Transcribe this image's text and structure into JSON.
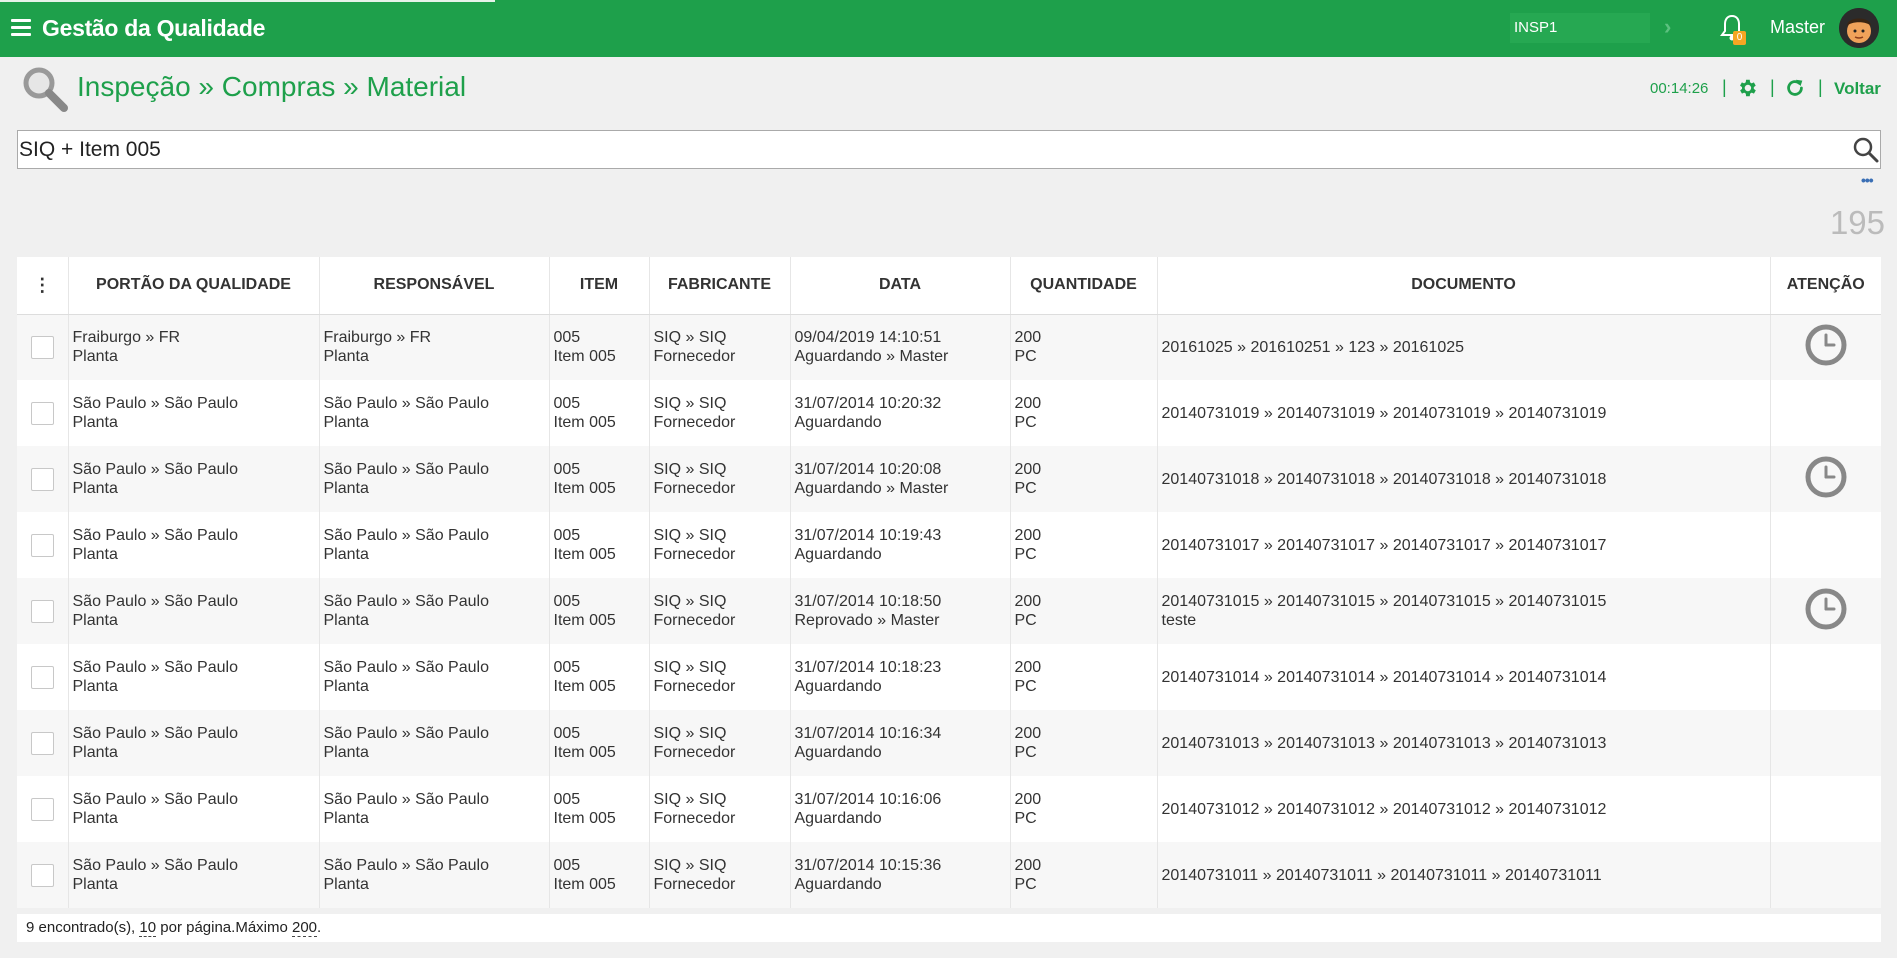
{
  "app": {
    "title": "Gestão da Qualidade"
  },
  "topbar": {
    "inspector": "INSP1",
    "notifications": "0",
    "user": "Master"
  },
  "header": {
    "breadcrumb": "Inspeção » Compras » Material",
    "timer": "00:14:26",
    "back": "Voltar"
  },
  "search": {
    "value": "SIQ + Item 005",
    "count": "195"
  },
  "table": {
    "columns": [
      "PORTÃO DA QUALIDADE",
      "RESPONSÁVEL",
      "ITEM",
      "FABRICANTE",
      "DATA",
      "QUANTIDADE",
      "DOCUMENTO",
      "ATENÇÃO"
    ],
    "rows": [
      {
        "portao1": "Fraiburgo » FR",
        "portao2": "Planta",
        "resp1": "Fraiburgo » FR",
        "resp2": "Planta",
        "item1": "005",
        "item2": "Item 005",
        "fab1": "SIQ » SIQ",
        "fab2": "Fornecedor",
        "data1": "09/04/2019 14:10:51",
        "data2": "Aguardando » Master",
        "qtd1": "200",
        "qtd2": "PC",
        "doc1": "20161025 » 201610251 » 123 » 20161025",
        "doc2": "",
        "atencao": true
      },
      {
        "portao1": "São Paulo » São Paulo",
        "portao2": "Planta",
        "resp1": "São Paulo » São Paulo",
        "resp2": "Planta",
        "item1": "005",
        "item2": "Item 005",
        "fab1": "SIQ » SIQ",
        "fab2": "Fornecedor",
        "data1": "31/07/2014 10:20:32",
        "data2": "Aguardando",
        "qtd1": "200",
        "qtd2": "PC",
        "doc1": "20140731019 » 20140731019 » 20140731019 » 20140731019",
        "doc2": "",
        "atencao": false
      },
      {
        "portao1": "São Paulo » São Paulo",
        "portao2": "Planta",
        "resp1": "São Paulo » São Paulo",
        "resp2": "Planta",
        "item1": "005",
        "item2": "Item 005",
        "fab1": "SIQ » SIQ",
        "fab2": "Fornecedor",
        "data1": "31/07/2014 10:20:08",
        "data2": "Aguardando » Master",
        "qtd1": "200",
        "qtd2": "PC",
        "doc1": "20140731018 » 20140731018 » 20140731018 » 20140731018",
        "doc2": "",
        "atencao": true
      },
      {
        "portao1": "São Paulo » São Paulo",
        "portao2": "Planta",
        "resp1": "São Paulo » São Paulo",
        "resp2": "Planta",
        "item1": "005",
        "item2": "Item 005",
        "fab1": "SIQ » SIQ",
        "fab2": "Fornecedor",
        "data1": "31/07/2014 10:19:43",
        "data2": "Aguardando",
        "qtd1": "200",
        "qtd2": "PC",
        "doc1": "20140731017 » 20140731017 » 20140731017 » 20140731017",
        "doc2": "",
        "atencao": false
      },
      {
        "portao1": "São Paulo » São Paulo",
        "portao2": "Planta",
        "resp1": "São Paulo » São Paulo",
        "resp2": "Planta",
        "item1": "005",
        "item2": "Item 005",
        "fab1": "SIQ » SIQ",
        "fab2": "Fornecedor",
        "data1": "31/07/2014 10:18:50",
        "data2": "Reprovado » Master",
        "qtd1": "200",
        "qtd2": "PC",
        "doc1": "20140731015 » 20140731015 » 20140731015 » 20140731015",
        "doc2": "teste",
        "atencao": true
      },
      {
        "portao1": "São Paulo » São Paulo",
        "portao2": "Planta",
        "resp1": "São Paulo » São Paulo",
        "resp2": "Planta",
        "item1": "005",
        "item2": "Item 005",
        "fab1": "SIQ » SIQ",
        "fab2": "Fornecedor",
        "data1": "31/07/2014 10:18:23",
        "data2": "Aguardando",
        "qtd1": "200",
        "qtd2": "PC",
        "doc1": "20140731014 » 20140731014 » 20140731014 » 20140731014",
        "doc2": "",
        "atencao": false
      },
      {
        "portao1": "São Paulo » São Paulo",
        "portao2": "Planta",
        "resp1": "São Paulo » São Paulo",
        "resp2": "Planta",
        "item1": "005",
        "item2": "Item 005",
        "fab1": "SIQ » SIQ",
        "fab2": "Fornecedor",
        "data1": "31/07/2014 10:16:34",
        "data2": "Aguardando",
        "qtd1": "200",
        "qtd2": "PC",
        "doc1": "20140731013 » 20140731013 » 20140731013 » 20140731013",
        "doc2": "",
        "atencao": false
      },
      {
        "portao1": "São Paulo » São Paulo",
        "portao2": "Planta",
        "resp1": "São Paulo » São Paulo",
        "resp2": "Planta",
        "item1": "005",
        "item2": "Item 005",
        "fab1": "SIQ » SIQ",
        "fab2": "Fornecedor",
        "data1": "31/07/2014 10:16:06",
        "data2": "Aguardando",
        "qtd1": "200",
        "qtd2": "PC",
        "doc1": "20140731012 » 20140731012 » 20140731012 » 20140731012",
        "doc2": "",
        "atencao": false
      },
      {
        "portao1": "São Paulo » São Paulo",
        "portao2": "Planta",
        "resp1": "São Paulo » São Paulo",
        "resp2": "Planta",
        "item1": "005",
        "item2": "Item 005",
        "fab1": "SIQ » SIQ",
        "fab2": "Fornecedor",
        "data1": "31/07/2014 10:15:36",
        "data2": "Aguardando",
        "qtd1": "200",
        "qtd2": "PC",
        "doc1": "20140731011 » 20140731011 » 20140731011 » 20140731011",
        "doc2": "",
        "atencao": false
      }
    ]
  },
  "footer": {
    "found": "9 encontrado(s), ",
    "per_page_value": "10",
    "per_page_label": " por página.Máximo ",
    "max_value": "200",
    "end": "."
  },
  "colors": {
    "brand": "#1ea04b",
    "icon_gray": "#888888"
  },
  "icons": {
    "menu": "hamburger-icon",
    "notifications": "bell-icon",
    "settings": "gear-icon",
    "refresh": "refresh-icon",
    "search": "search-icon",
    "attention": "clock-icon"
  }
}
